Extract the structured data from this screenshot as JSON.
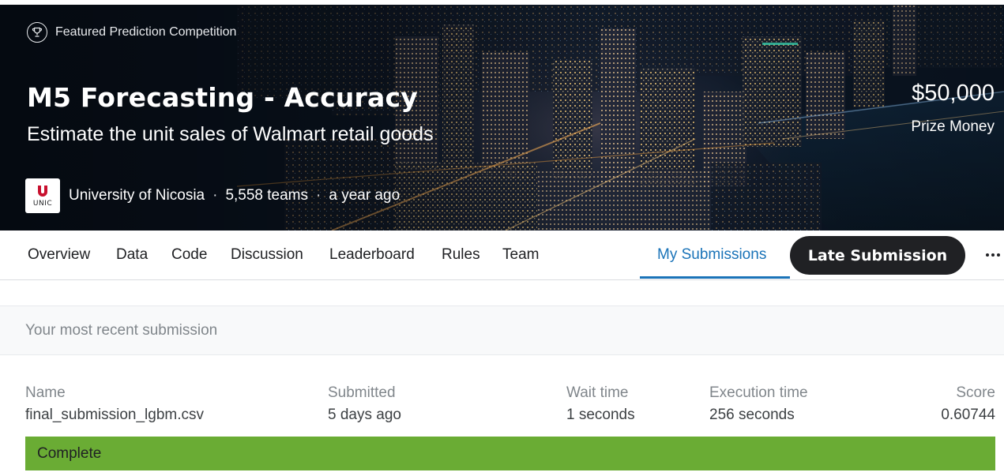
{
  "hero": {
    "featured_label": "Featured Prediction Competition",
    "title": "M5 Forecasting - Accuracy",
    "subtitle": "Estimate the unit sales of Walmart retail goods",
    "prize_amount": "$50,000",
    "prize_label": "Prize Money",
    "host_logo_text": "UNIC",
    "host_name": "University of Nicosia",
    "separator": "·",
    "teams": "5,558 teams",
    "time_ago": "a year ago",
    "logo_color": "#c8102e"
  },
  "nav": {
    "tabs": [
      "Overview",
      "Data",
      "Code",
      "Discussion",
      "Leaderboard",
      "Rules",
      "Team"
    ],
    "active_tab": "My Submissions",
    "late_submission_label": "Late Submission",
    "accent_color": "#1a73b8"
  },
  "submission": {
    "header": "Your most recent submission",
    "columns": {
      "name": "Name",
      "submitted": "Submitted",
      "wait_time": "Wait time",
      "execution_time": "Execution time",
      "score": "Score"
    },
    "values": {
      "name": "final_submission_lgbm.csv",
      "submitted": "5 days ago",
      "wait_time": "1 seconds",
      "execution_time": "256 seconds",
      "score": "0.60744"
    },
    "status": "Complete",
    "status_color": "#6aac34"
  }
}
